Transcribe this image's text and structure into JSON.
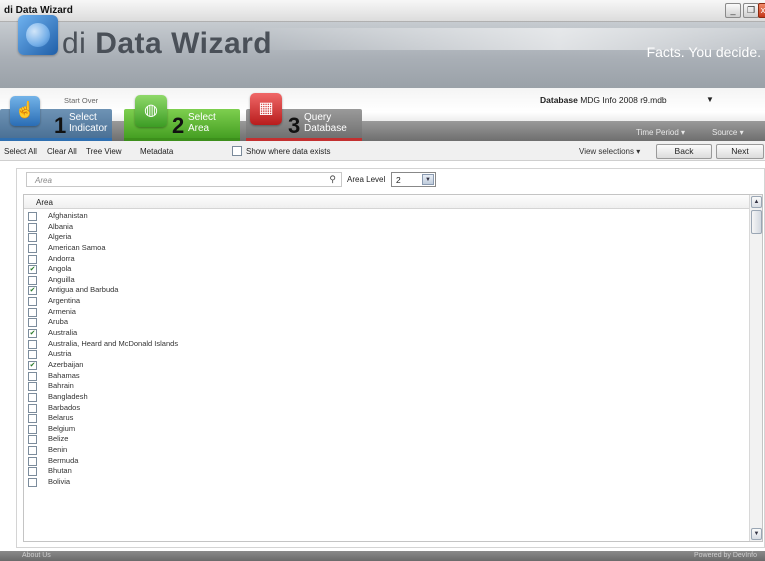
{
  "window": {
    "title": "di Data Wizard",
    "controls": [
      "_",
      "❐",
      "x"
    ]
  },
  "header": {
    "app_prefix": "di",
    "app_name": "Data Wizard",
    "tagline": "Facts. You decide."
  },
  "steps": {
    "start_over": "Start Over",
    "items": [
      {
        "num": "1",
        "label_line1": "Select",
        "label_line2": "Indicator",
        "icon": "indicator-icon",
        "color": "#476d92"
      },
      {
        "num": "2",
        "label_line1": "Select",
        "label_line2": "Area",
        "icon": "globe-icon",
        "color": "#3f9a1e"
      },
      {
        "num": "3",
        "label_line1": "Query",
        "label_line2": "Database",
        "icon": "database-grid-icon",
        "color": "#c23030"
      }
    ],
    "database_label": "Database",
    "database_value": "MDG Info 2008 r9.mdb",
    "time_period": "Time Period",
    "source": "Source"
  },
  "toolbar": {
    "select_all": "Select All",
    "clear_all": "Clear All",
    "tree_view": "Tree View",
    "metadata": "Metadata",
    "show_where": "Show where data exists",
    "view_selections": "View selections",
    "back": "Back",
    "next": "Next"
  },
  "search": {
    "placeholder": "Area",
    "icon": "search-icon"
  },
  "area_level": {
    "label": "Area Level",
    "value": "2"
  },
  "list": {
    "header": "Area",
    "rows": [
      {
        "label": "Afghanistan",
        "checked": false
      },
      {
        "label": "Albania",
        "checked": false
      },
      {
        "label": "Algeria",
        "checked": false
      },
      {
        "label": "American Samoa",
        "checked": false
      },
      {
        "label": "Andorra",
        "checked": false
      },
      {
        "label": "Angola",
        "checked": true
      },
      {
        "label": "Anguilla",
        "checked": false
      },
      {
        "label": "Antigua and Barbuda",
        "checked": true
      },
      {
        "label": "Argentina",
        "checked": false
      },
      {
        "label": "Armenia",
        "checked": false
      },
      {
        "label": "Aruba",
        "checked": false
      },
      {
        "label": "Australia",
        "checked": true
      },
      {
        "label": "Australia, Heard and McDonald Islands",
        "checked": false
      },
      {
        "label": "Austria",
        "checked": false
      },
      {
        "label": "Azerbaijan",
        "checked": true
      },
      {
        "label": "Bahamas",
        "checked": false
      },
      {
        "label": "Bahrain",
        "checked": false
      },
      {
        "label": "Bangladesh",
        "checked": false
      },
      {
        "label": "Barbados",
        "checked": false
      },
      {
        "label": "Belarus",
        "checked": false
      },
      {
        "label": "Belgium",
        "checked": false
      },
      {
        "label": "Belize",
        "checked": false
      },
      {
        "label": "Benin",
        "checked": false
      },
      {
        "label": "Bermuda",
        "checked": false
      },
      {
        "label": "Bhutan",
        "checked": false
      },
      {
        "label": "Bolivia",
        "checked": false
      }
    ]
  },
  "footer": {
    "left": "About Us",
    "right": "Powered by DevInfo"
  }
}
